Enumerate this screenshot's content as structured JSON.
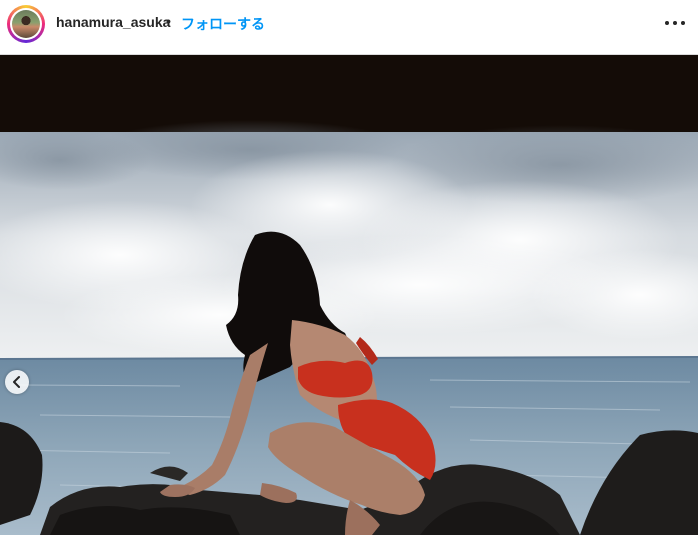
{
  "header": {
    "username": "hanamura_asuka",
    "separator": "•",
    "follow_label": "フォローする",
    "more_icon": "more-horizontal-icon"
  },
  "colors": {
    "follow_blue": "#0095f6",
    "username": "#262626",
    "swimsuit": "#c8301e",
    "sea": "#6d8aa2"
  },
  "carousel": {
    "prev_icon": "chevron-left-icon"
  }
}
